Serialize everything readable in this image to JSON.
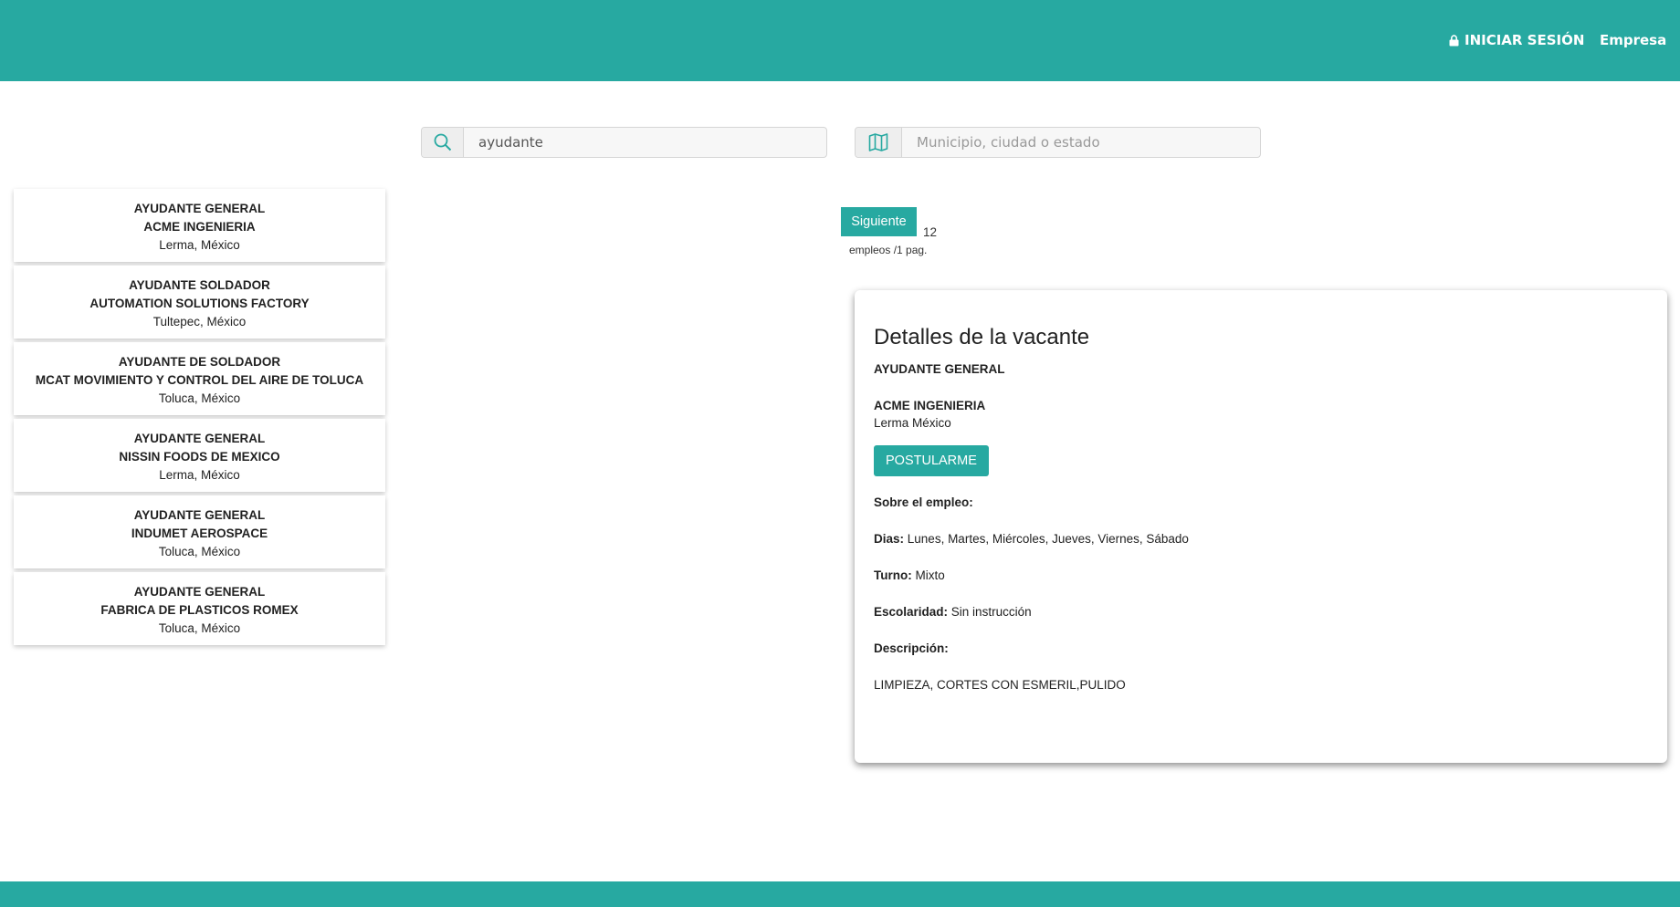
{
  "header": {
    "login_label": "INICIAR SESIÓN",
    "company_label": "Empresa"
  },
  "search": {
    "query_value": "ayudante",
    "location_placeholder": "Municipio, ciudad o estado"
  },
  "colors": {
    "accent": "#27a9a1",
    "header_bg": "#27a9a1"
  },
  "jobs": [
    {
      "title": "AYUDANTE GENERAL",
      "company": "ACME INGENIERIA",
      "location": "Lerma, México"
    },
    {
      "title": "AYUDANTE SOLDADOR",
      "company": "AUTOMATION SOLUTIONS FACTORY",
      "location": "Tultepec, México"
    },
    {
      "title": "AYUDANTE DE SOLDADOR",
      "company": "MCAT MOVIMIENTO Y CONTROL DEL AIRE DE TOLUCA",
      "location": "Toluca, México"
    },
    {
      "title": "AYUDANTE GENERAL",
      "company": "NISSIN FOODS DE MEXICO",
      "location": "Lerma, México"
    },
    {
      "title": "AYUDANTE GENERAL",
      "company": "INDUMET AEROSPACE",
      "location": "Toluca, México"
    },
    {
      "title": "AYUDANTE GENERAL",
      "company": "FABRICA DE PLASTICOS ROMEX",
      "location": "Toluca, México"
    }
  ],
  "pager": {
    "next_label": "Siguiente",
    "count": "12",
    "count_suffix": "empleos /1 pag."
  },
  "detail": {
    "heading": "Detalles de la vacante",
    "title": "AYUDANTE GENERAL",
    "company": "ACME INGENIERIA",
    "location": "Lerma México",
    "apply_label": "POSTULARME",
    "about_label": "Sobre el empleo:",
    "days_label": "Dias:",
    "days_value": "Lunes, Martes, Miércoles, Jueves, Viernes, Sábado",
    "shift_label": "Turno:",
    "shift_value": "Mixto",
    "education_label": "Escolaridad:",
    "education_value": "Sin instrucción",
    "description_label": "Descripción:",
    "description_value": "LIMPIEZA, CORTES CON ESMERIL,PULIDO"
  },
  "icons": {
    "login": "lock-icon",
    "search": "search-icon",
    "location": "map-icon"
  }
}
